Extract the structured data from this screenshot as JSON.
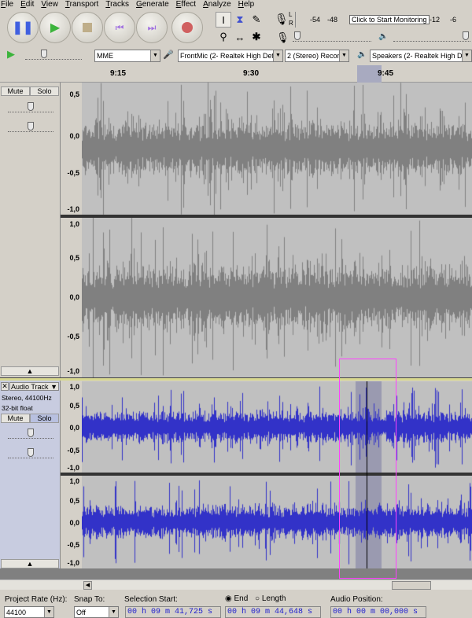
{
  "menu": [
    "File",
    "Edit",
    "View",
    "Transport",
    "Tracks",
    "Generate",
    "Effect",
    "Analyze",
    "Help"
  ],
  "transport": {
    "pause": "pause-icon",
    "play": "play-icon",
    "stop": "stop-icon",
    "skip_start": "skip-start-icon",
    "skip_end": "skip-end-icon",
    "record": "record-icon"
  },
  "meter": {
    "ticks": [
      "-54",
      "-48",
      "-12",
      "-6"
    ],
    "tooltip": "Click to Start Monitoring",
    "l": "L",
    "r": "R"
  },
  "device": {
    "host": "MME",
    "input": "FrontMic (2- Realtek High Defi",
    "channels": "2 (Stereo) Record",
    "output": "Speakers (2- Realtek High Defi"
  },
  "ruler": {
    "labels": [
      "9:15",
      "9:30",
      "9:45"
    ]
  },
  "track1": {
    "mute": "Mute",
    "solo": "Solo",
    "scale1": [
      "0,5",
      "0,0",
      "-0,5",
      "-1,0"
    ],
    "scale2": [
      "1,0",
      "0,5",
      "0,0",
      "-0,5",
      "-1,0"
    ]
  },
  "track2": {
    "name": "Audio Track",
    "info1": "Stereo, 44100Hz",
    "info2": "32-bit float",
    "mute": "Mute",
    "solo": "Solo",
    "scale": [
      "1,0",
      "0,5",
      "0,0",
      "-0,5",
      "-1,0"
    ],
    "color": "#3232c8"
  },
  "colors": {
    "wave_gray": "#808080",
    "wave_blue": "#3232c8",
    "highlight": "#ff40ff"
  },
  "bottom": {
    "rate_label": "Project Rate (Hz):",
    "rate": "44100",
    "snap_label": "Snap To:",
    "snap": "Off",
    "sel_start_label": "Selection Start:",
    "end": "End",
    "length": "Length",
    "sel_start": "00 h 09 m 41,725 s",
    "sel_end": "00 h 09 m 44,648 s",
    "audio_pos_label": "Audio Position:",
    "audio_pos": "00 h 00 m 00,000 s"
  }
}
